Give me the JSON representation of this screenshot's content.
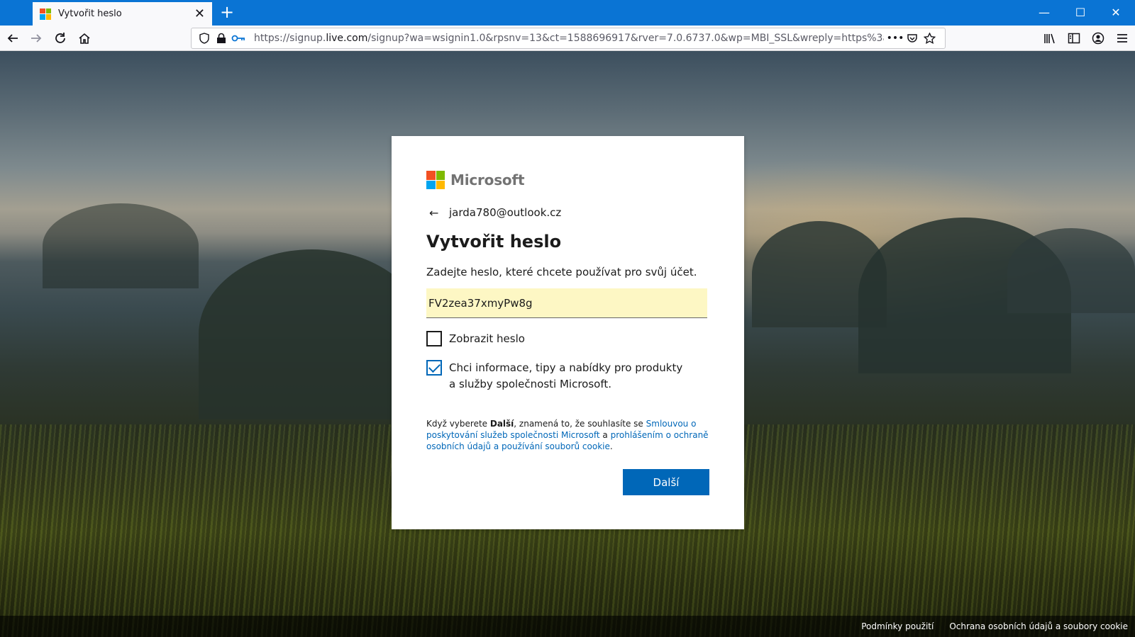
{
  "browser": {
    "tab_title": "Vytvořit heslo",
    "url_prefix": "https://signup.",
    "url_host": "live.com",
    "url_suffix": "/signup?wa=wsignin1.0&rpsnv=13&ct=1588696917&rver=7.0.6737.0&wp=MBI_SSL&wreply=https%3a%",
    "url_more": "•••"
  },
  "brand": {
    "name": "Microsoft",
    "colors": [
      "#f25022",
      "#7fba00",
      "#00a4ef",
      "#ffb900"
    ]
  },
  "dialog": {
    "back_icon": "←",
    "email": "jarda780@outlook.cz",
    "title": "Vytvořit heslo",
    "subtitle": "Zadejte heslo, které chcete používat pro svůj účet.",
    "password_value": "FV2zea37xmyPw8g",
    "show_password_label": "Zobrazit heslo",
    "show_password_checked": false,
    "marketing_label": "Chci informace, tipy a nabídky pro produkty a služby společnosti Microsoft.",
    "marketing_checked": true,
    "legal_part1": "Když vyberete ",
    "legal_bold": "Další",
    "legal_part2": ", znamená to, že souhlasíte se ",
    "legal_link1": "Smlouvou o poskytování služeb společnosti Microsoft",
    "legal_part3": " a ",
    "legal_link2": "prohlášením o ochraně osobních údajů a používání souborů cookie",
    "legal_part4": ".",
    "next_label": "Další"
  },
  "footer": {
    "terms": "Podmínky použití",
    "privacy": "Ochrana osobních údajů a soubory cookie"
  },
  "colors": {
    "accent": "#0067b8",
    "titlebar": "#0a74d4",
    "input_fill": "#fdf7c4"
  }
}
